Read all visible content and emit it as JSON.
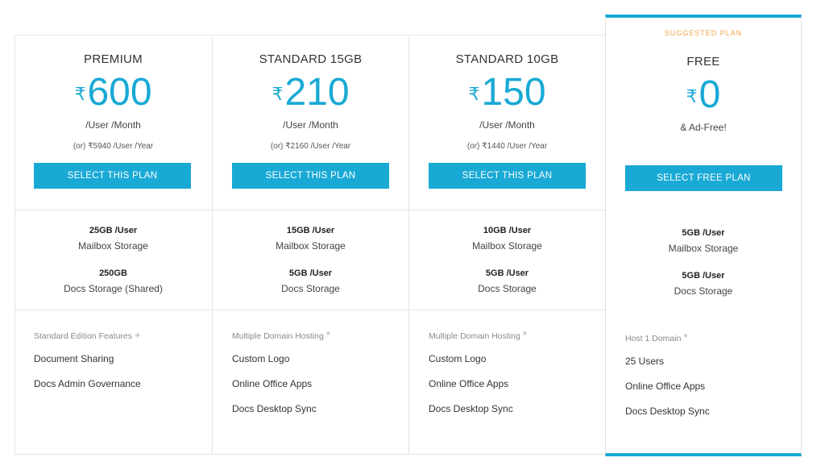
{
  "suggested_label": "SUGGESTED PLAN",
  "currency_symbol": "₹",
  "plans": [
    {
      "name": "PREMIUM",
      "price": "600",
      "period": "/User /Month",
      "yearly": "(or) ₹5940 /User /Year",
      "button": "SELECT THIS PLAN",
      "mailbox_amount": "25GB /User",
      "mailbox_label": "Mailbox Storage",
      "docs_amount": "250GB",
      "docs_label": "Docs Storage (Shared)",
      "features_head": "Standard Edition Features",
      "features_mark": "+",
      "features": [
        "Document Sharing",
        "Docs Admin Governance"
      ]
    },
    {
      "name": "STANDARD 15GB",
      "price": "210",
      "period": "/User /Month",
      "yearly": "(or) ₹2160 /User /Year",
      "button": "SELECT THIS PLAN",
      "mailbox_amount": "15GB /User",
      "mailbox_label": "Mailbox Storage",
      "docs_amount": "5GB /User",
      "docs_label": "Docs Storage",
      "features_head": "Multiple Domain Hosting",
      "features_mark": "*",
      "features": [
        "Custom Logo",
        "Online Office Apps",
        "Docs Desktop Sync"
      ]
    },
    {
      "name": "STANDARD 10GB",
      "price": "150",
      "period": "/User /Month",
      "yearly": "(or) ₹1440 /User /Year",
      "button": "SELECT THIS PLAN",
      "mailbox_amount": "10GB /User",
      "mailbox_label": "Mailbox Storage",
      "docs_amount": "5GB /User",
      "docs_label": "Docs Storage",
      "features_head": "Multiple Domain Hosting",
      "features_mark": "*",
      "features": [
        "Custom Logo",
        "Online Office Apps",
        "Docs Desktop Sync"
      ]
    },
    {
      "name": "FREE",
      "price": "0",
      "period": "& Ad-Free!",
      "yearly": "",
      "button": "SELECT FREE PLAN",
      "mailbox_amount": "5GB /User",
      "mailbox_label": "Mailbox Storage",
      "docs_amount": "5GB /User",
      "docs_label": "Docs Storage",
      "features_head": "Host 1 Domain",
      "features_mark": "*",
      "features": [
        "25 Users",
        "Online Office Apps",
        "Docs Desktop Sync"
      ]
    }
  ],
  "colors": {
    "accent": "#19a9d5",
    "suggested": "#f0a34a",
    "border": "#e6e6e6"
  }
}
